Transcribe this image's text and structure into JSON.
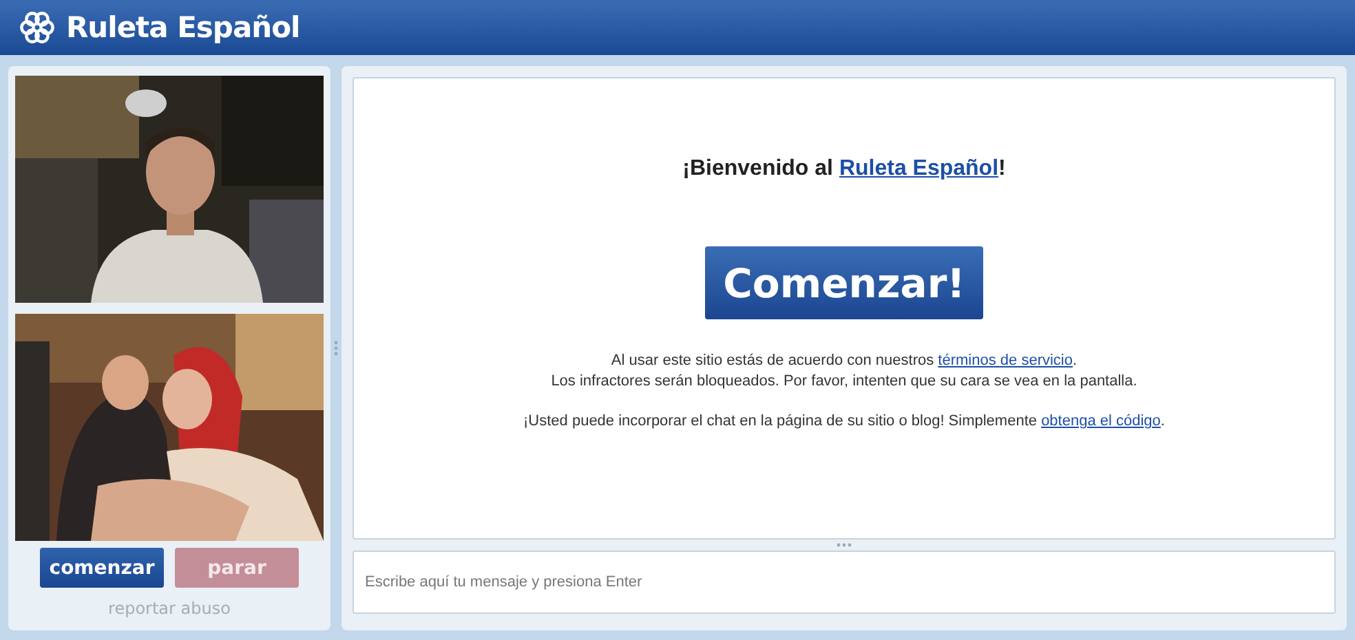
{
  "header": {
    "title": "Ruleta Español"
  },
  "video_panel": {
    "buttons": [
      {
        "label": "comenzar",
        "disabled": false
      },
      {
        "label": "parar",
        "disabled": true
      }
    ],
    "report_link": "reportar abuso"
  },
  "welcome": {
    "before": "¡Bienvenido al ",
    "link": "Ruleta Español",
    "after": "!"
  },
  "start_button": "Comenzar!",
  "notice_lines": [
    {
      "before": "Al usar este sitio estás de acuerdo con nuestros ",
      "link": "términos de servicio",
      "after": "."
    },
    {
      "before": "Los infractores serán bloqueados. Por favor, intenten que su cara se vea en la pantalla."
    }
  ],
  "embed_line": {
    "before": "¡Usted puede incorporar el chat en la página de su sitio o blog! Simplemente ",
    "link": "obtenga el código",
    "after": "."
  },
  "message_input": {
    "placeholder": "Escribe aquí tu mensaje y presiona Enter"
  }
}
